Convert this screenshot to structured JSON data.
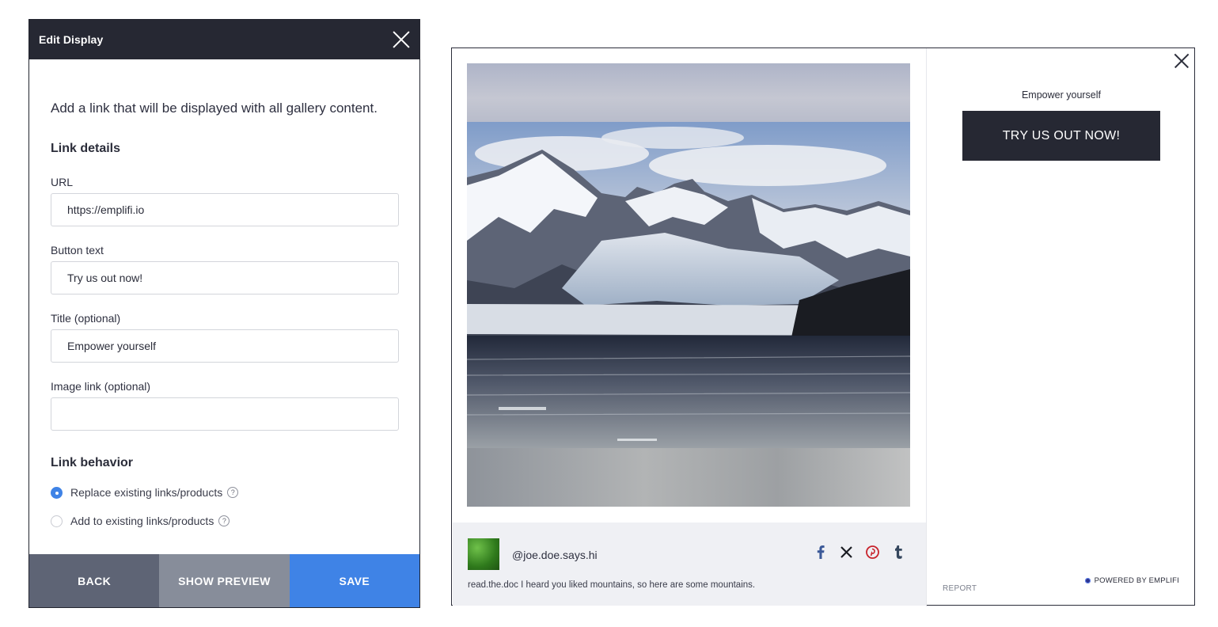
{
  "editor": {
    "title": "Edit Display",
    "intro": "Add a link that will be displayed with all gallery content.",
    "link_details_heading": "Link details",
    "url_label": "URL",
    "url_value": "https://emplifi.io",
    "button_text_label": "Button text",
    "button_text_value": "Try us out now!",
    "title_label": "Title (optional)",
    "title_value": "Empower yourself",
    "image_link_label": "Image link (optional)",
    "image_link_value": "",
    "link_behavior_heading": "Link behavior",
    "behavior_options": [
      {
        "label": "Replace existing links/products",
        "selected": true
      },
      {
        "label": "Add to existing links/products",
        "selected": false
      }
    ],
    "help_glyph": "?",
    "footer": {
      "back": "BACK",
      "show_preview": "SHOW PREVIEW",
      "save": "SAVE"
    }
  },
  "preview": {
    "handle": "@joe.doe.says.hi",
    "caption": "read.the.doc I heard you liked mountains, so here are some mountains.",
    "social_icons": [
      "facebook-icon",
      "x-icon",
      "pinterest-icon",
      "tumblr-icon"
    ],
    "cta_title": "Empower yourself",
    "cta_button": "TRY US OUT NOW!",
    "report": "REPORT",
    "powered_by": "POWERED BY EMPLIFI"
  },
  "colors": {
    "header_dark": "#262833",
    "accent_blue": "#3f83e6",
    "back_button": "#5e6475",
    "preview_button": "#878d9a",
    "facebook": "#3b5998",
    "pinterest": "#c8232c",
    "tumblr": "#34465d"
  }
}
